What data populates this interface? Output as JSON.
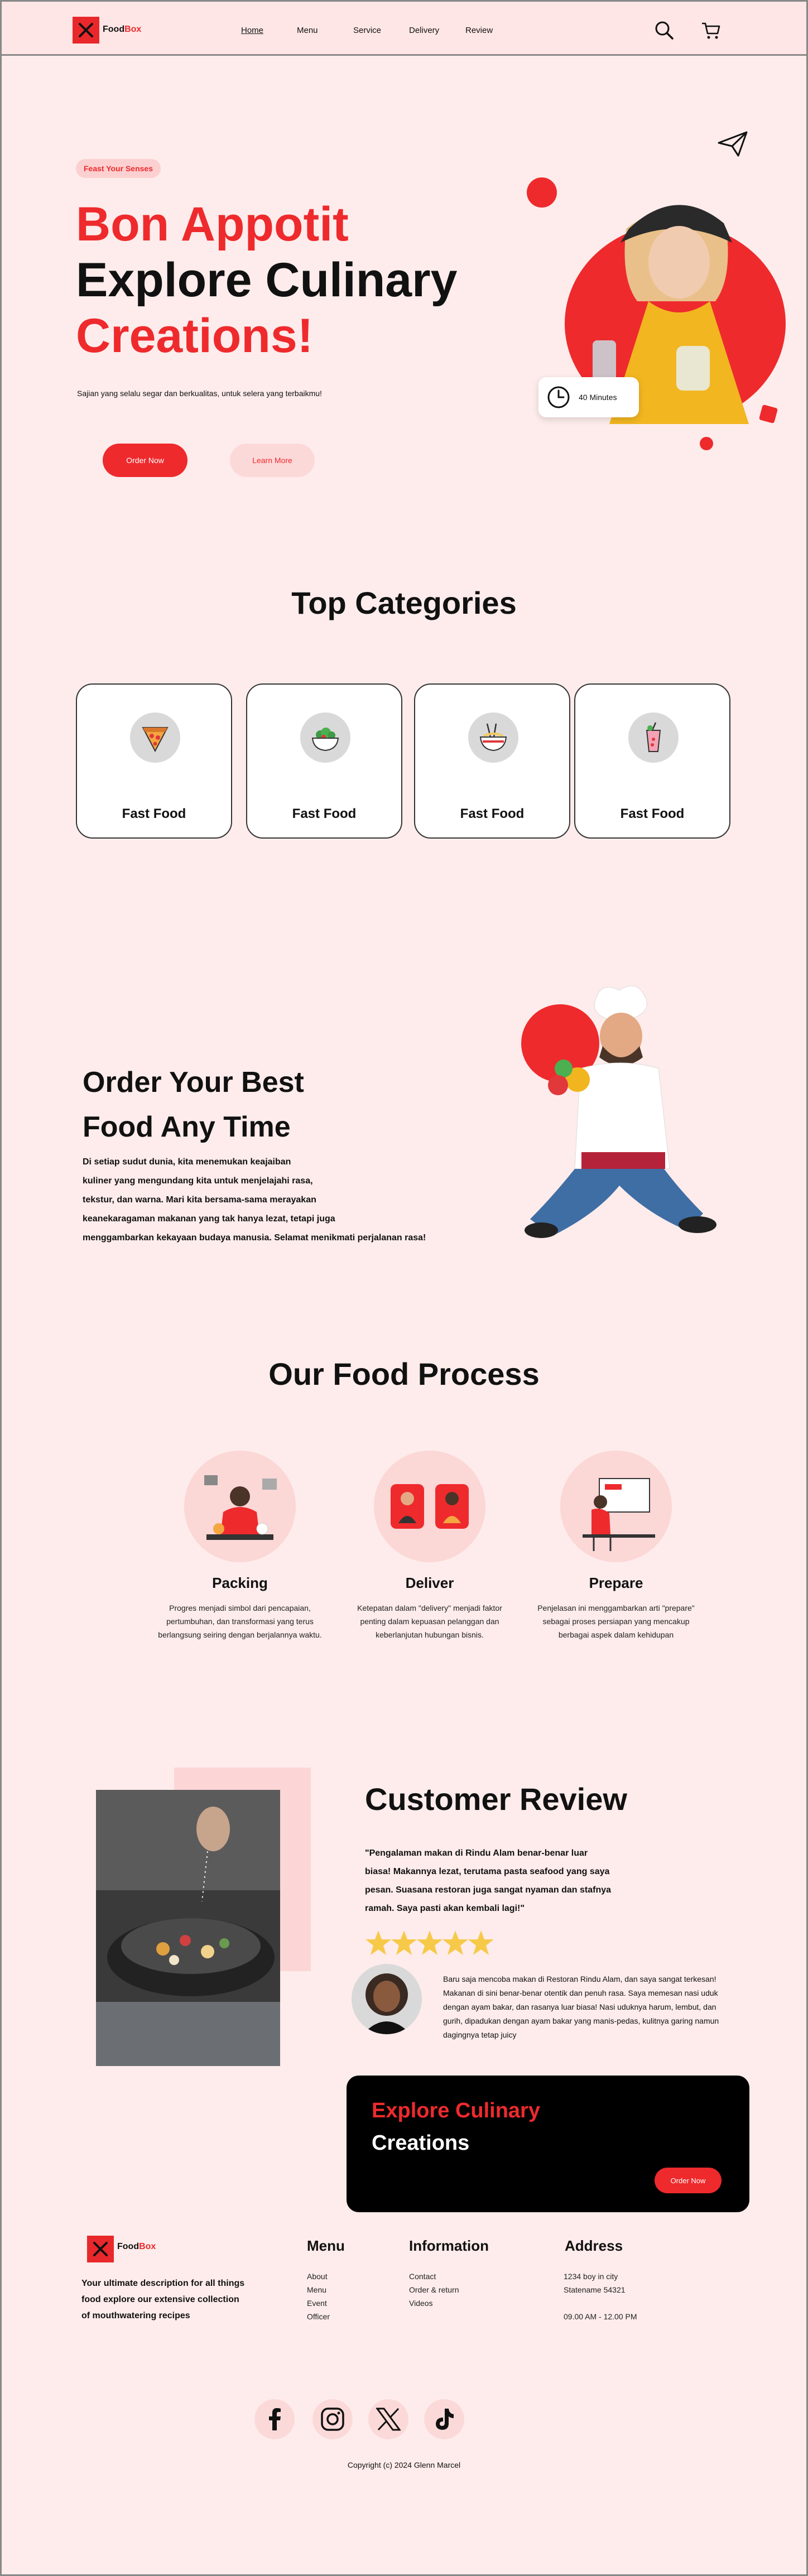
{
  "nav": {
    "brand_part1": "Food",
    "brand_part2": "Box",
    "links": [
      "Home",
      "Menu",
      "Service",
      "Delivery",
      "Review"
    ]
  },
  "hero": {
    "badge": "Feast Your Senses",
    "title_line1": "Bon Appotit",
    "title_line2": "Explore Culinary",
    "title_line3": "Creations!",
    "subtitle": "Sajian yang selalu segar dan berkualitas, untuk selera yang terbaikmu!",
    "order_button": "Order Now",
    "learn_button": "Learn More",
    "time_badge": "40 Minutes"
  },
  "categories": {
    "heading": "Top Categories",
    "items": [
      {
        "label": "Fast Food",
        "icon": "pizza-icon"
      },
      {
        "label": "Fast Food",
        "icon": "salad-bowl-icon"
      },
      {
        "label": "Fast Food",
        "icon": "noodle-bowl-icon"
      },
      {
        "label": "Fast Food",
        "icon": "drink-icon"
      }
    ]
  },
  "order_section": {
    "title_line1": "Order Your Best",
    "title_line2": "Food Any Time",
    "body_line1": "Di setiap sudut dunia, kita menemukan keajaiban",
    "body_line2": "kuliner yang mengundang kita untuk menjelajahi rasa,",
    "body_line3": "tekstur, dan warna. Mari kita bersama-sama merayakan",
    "body_line4": "keanekaragaman makanan yang tak hanya lezat, tetapi juga",
    "body_line5": "menggambarkan kekayaan budaya manusia. Selamat menikmati perjalanan rasa!"
  },
  "process": {
    "heading": "Our Food Process",
    "steps": [
      {
        "title": "Packing",
        "l1": "Progres menjadi simbol dari pencapaian,",
        "l2": "pertumbuhan, dan transformasi yang terus",
        "l3": "berlangsung seiring dengan berjalannya waktu."
      },
      {
        "title": "Deliver",
        "l1": "Ketepatan dalam \"delivery\" menjadi faktor",
        "l2": "penting dalam kepuasan pelanggan dan",
        "l3": "keberlanjutan hubungan bisnis."
      },
      {
        "title": "Prepare",
        "l1": "Penjelasan ini menggambarkan arti \"prepare\"",
        "l2": "sebagai proses persiapan yang mencakup",
        "l3": "berbagai aspek dalam kehidupan"
      }
    ]
  },
  "review": {
    "heading": "Customer Review",
    "quote_l1": "\"Pengalaman makan di Rindu Alam benar-benar luar",
    "quote_l2": "biasa! Makannya lezat, terutama pasta seafood yang saya",
    "quote_l3": "pesan. Suasana restoran juga sangat nyaman dan stafnya",
    "quote_l4": "ramah. Saya pasti akan kembali lagi!\"",
    "stars": 5,
    "detail_l1": "Baru saja mencoba makan di Restoran Rindu Alam, dan saya sangat terkesan!",
    "detail_l2": "Makanan di sini benar-benar otentik dan penuh rasa. Saya memesan nasi uduk",
    "detail_l3": "dengan ayam bakar, dan rasanya luar biasa! Nasi uduknya harum, lembut, dan",
    "detail_l4": "gurih, dipadukan dengan ayam bakar yang manis-pedas, kulitnya garing namun",
    "detail_l5": "dagingnya tetap juicy"
  },
  "cta": {
    "line1": "Explore Culinary",
    "line2": "Creations",
    "button": "Order Now"
  },
  "footer": {
    "brand_part1": "Food",
    "brand_part2": "Box",
    "desc_l1": "Your ultimate description for all things",
    "desc_l2": "food explore our extensive collection",
    "desc_l3": "of mouthwatering recipes",
    "menu_title": "Menu",
    "menu_items": [
      "About",
      "Menu",
      "Event",
      "Officer"
    ],
    "info_title": "Information",
    "info_items": [
      "Contact",
      "Order & return",
      "Videos"
    ],
    "address_title": "Address",
    "address_l1": "1234 boy in city",
    "address_l2": "Statename 54321",
    "hours": "09.00 AM - 12.00 PM",
    "copyright": "Copyright (c) 2024 Glenn Marcel"
  },
  "colors": {
    "accent": "#ee2a2d",
    "background": "#fdeceb",
    "soft_pink": "#fcd9d9",
    "star": "#f7c948"
  }
}
